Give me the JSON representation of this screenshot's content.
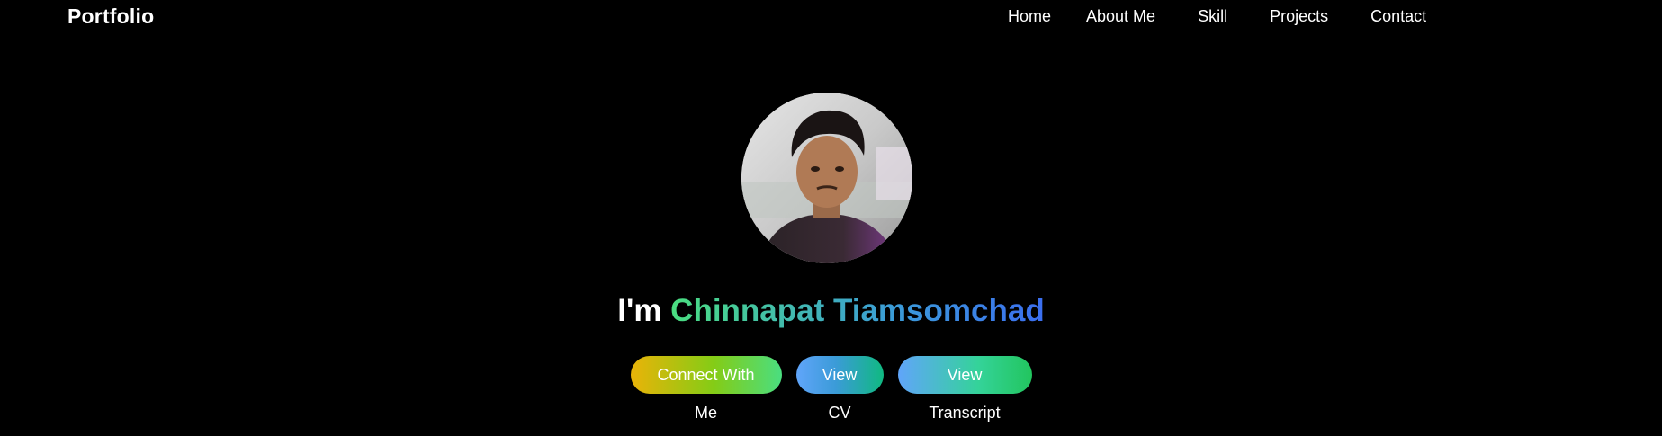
{
  "navbar": {
    "brand": "Portfolio",
    "links": [
      {
        "label": "Home"
      },
      {
        "label": "About Me"
      },
      {
        "label": "Skill"
      },
      {
        "label": "Projects"
      },
      {
        "label": "Contact"
      }
    ]
  },
  "hero": {
    "avatar_icon": "profile-photo",
    "greeting_prefix": "I'm",
    "name": "Chinnapat Tiamsomchad",
    "buttons": {
      "connect": "Connect With Me",
      "cv": "View CV",
      "transcript": "View Transcript"
    }
  },
  "colors": {
    "background": "#000000",
    "name_gradient_start": "#4ade80",
    "name_gradient_end": "#3b6ef0",
    "connect_gradient_start": "#eab308",
    "connect_gradient_end": "#4ade80",
    "blue_green_start": "#60a5fa",
    "blue_green_end": "#22c55e"
  }
}
